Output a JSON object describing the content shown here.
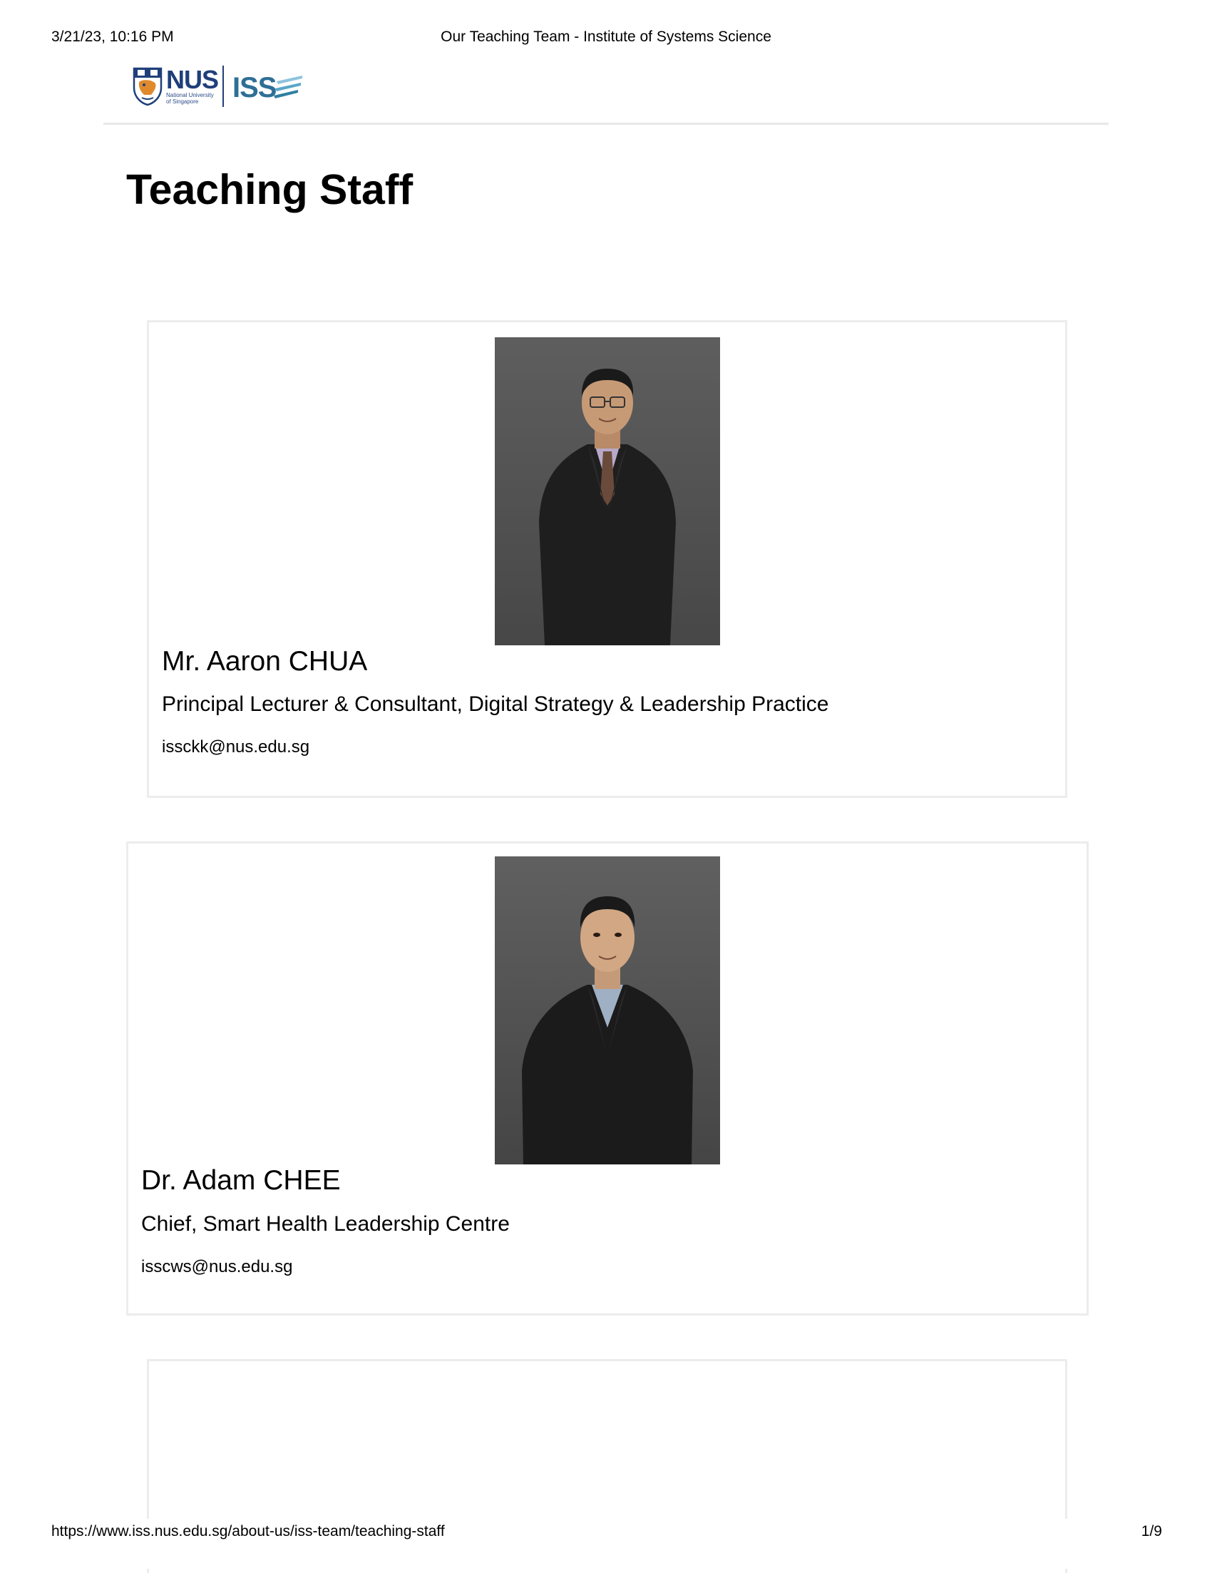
{
  "print_header": {
    "datetime": "3/21/23, 10:16 PM",
    "page_title": "Our Teaching Team - Institute of Systems Science"
  },
  "site": {
    "logo": {
      "wordmark": "NUS",
      "subtitle_line1": "National University",
      "subtitle_line2": "of Singapore",
      "partner_mark": "ISS"
    }
  },
  "main": {
    "heading": "Teaching Staff",
    "staff": [
      {
        "name": "Mr. Aaron CHUA",
        "role": "Principal Lecturer & Consultant, Digital Strategy & Leadership Practice",
        "email": "issckk@nus.edu.sg"
      },
      {
        "name": "Dr. Adam CHEE",
        "role": "Chief, Smart Health Leadership Centre",
        "email": "isscws@nus.edu.sg"
      }
    ]
  },
  "print_footer": {
    "url": "https://www.iss.nus.edu.sg/about-us/iss-team/teaching-staff",
    "page": "1/9"
  },
  "colors": {
    "brand_blue": "#1f3f7a",
    "iss_teal": "#2e7fa0",
    "card_border": "#ececec",
    "photo_bg": "#505050"
  }
}
